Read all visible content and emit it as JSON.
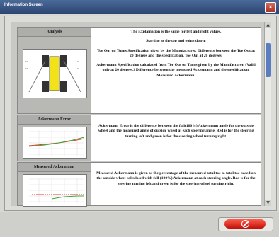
{
  "window": {
    "title": "Information Screen"
  },
  "rows": [
    {
      "heading": "Analysis",
      "paragraphs": [
        "The Explaination is the same for left and right values.",
        "Starting at the top and going down:",
        "Toe Out on Turns Specification given by the Manufacturer. Difference between the Toe Out at 20 degrees and the specification. Toe Out at 20 degrees.",
        "Ackermann Specification calculated from Toe Out on Turns given by the Manufacturer. (Valid only at 20 degrees.) Difference between the measured Ackermann and the specification. Measured Ackermann."
      ]
    },
    {
      "heading": "Ackermann Error",
      "paragraphs": [
        "Ackermann Error is the difference between the full(100%) Ackermann angle for the outside wheel and the measured angle of outside wheel at each steering angle. Red is for the steering turning left and green is for the steering wheel turning right."
      ]
    },
    {
      "heading": "Measured Ackermann",
      "paragraphs": [
        "Measured Ackermann is given as the percentage of the measured total toe to total toe based on the outside wheel calculated with full (100%) Ackermann at each steering angle. Red is for the steering turning left and green is for the steering wheel turning right."
      ]
    }
  ],
  "colors": {
    "left_turn": "#e23b2e",
    "right_turn": "#38a83a",
    "cancel": "#e02a1c"
  },
  "buttons": {
    "cancel_icon": "cancel-icon"
  }
}
